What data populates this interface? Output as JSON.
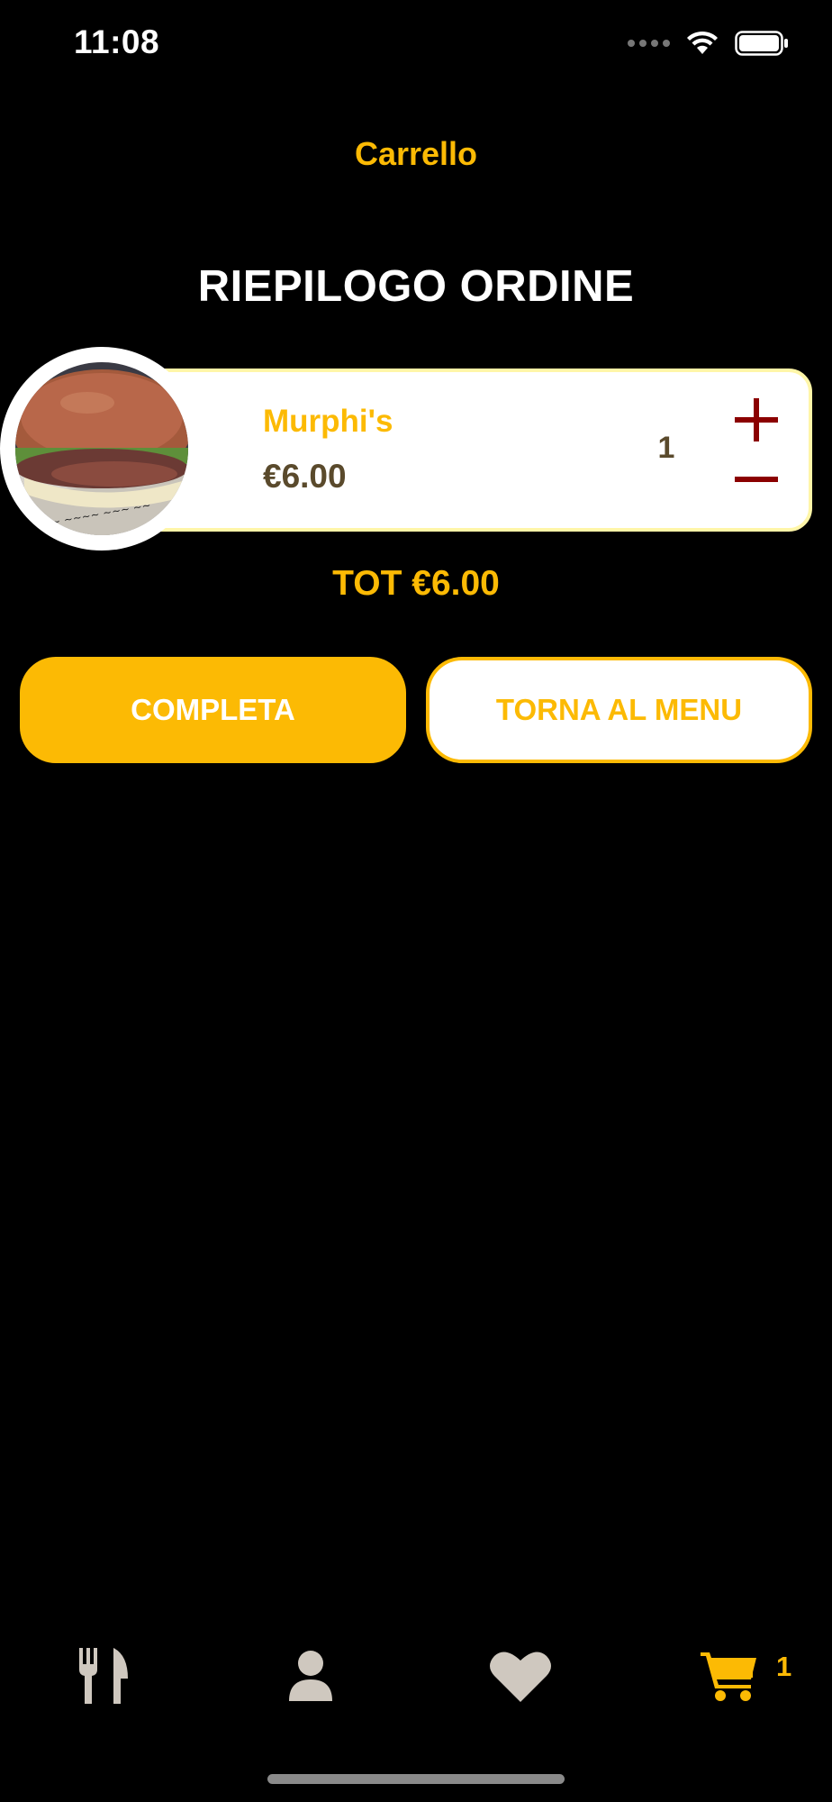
{
  "status_bar": {
    "time": "11:08"
  },
  "nav": {
    "title": "Carrello"
  },
  "summary": {
    "heading": "RIEPILOGO ORDINE"
  },
  "cart_items": [
    {
      "name": "Murphi's",
      "price": "€6.00",
      "quantity": "1"
    }
  ],
  "total": "TOT €6.00",
  "buttons": {
    "complete": "COMPLETA",
    "back_to_menu": "TORNA AL MENU"
  },
  "tab_bar": {
    "items": [
      {
        "name": "menu",
        "icon": "fork-knife-icon"
      },
      {
        "name": "profile",
        "icon": "user-icon"
      },
      {
        "name": "favorites",
        "icon": "heart-icon"
      },
      {
        "name": "cart",
        "icon": "cart-icon",
        "badge": "1",
        "active": true
      }
    ]
  },
  "colors": {
    "accent": "#FCBA04",
    "price_text": "#5a4a2c",
    "qty_controls": "#8B0000",
    "inactive_icon": "#CFC8BF"
  }
}
